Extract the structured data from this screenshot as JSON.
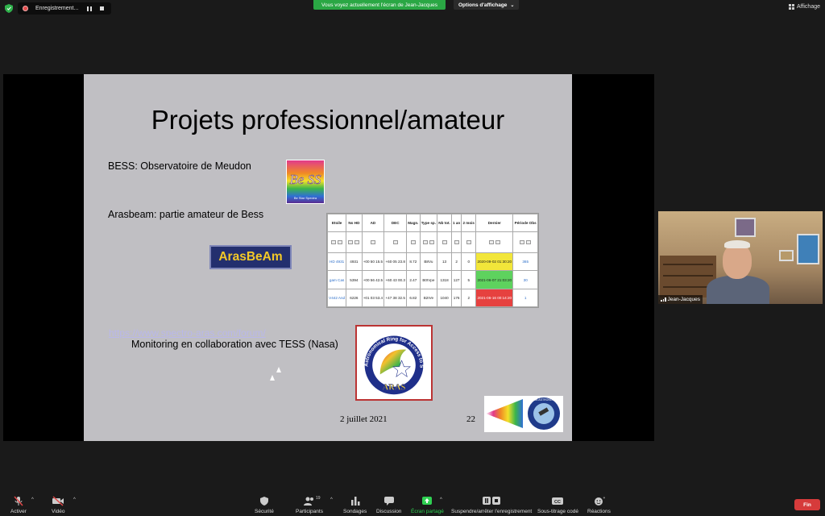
{
  "top_bar": {
    "recording_label": "Enregistrement...",
    "viewing_banner": "Vous voyez actuellement l'écran de Jean-Jacques",
    "view_options": "Options d'affichage",
    "display_label": "Affichage"
  },
  "slide": {
    "title": "Projets professionnel/amateur",
    "bess_text": "BESS: Observatoire de Meudon",
    "arasbeam_text": "Arasbeam: partie amateur de Bess",
    "link": "https://www.spectro-aras.com/forum/",
    "monitoring_text": "Monitoring en collaboration avec TESS (Nasa)",
    "date": "2 juillet 2021",
    "page_number": "22",
    "bess_logo_text": "Be SS",
    "bess_logo_sub": "Be Star Spectra",
    "arasbeam_logo": "ArasBeAm",
    "aras_logo_ring": "Astronomical Ring for Access to Spectroscopy",
    "aras_logo_name": "ARAS",
    "corner_logo_text": "CLUB ASTRONOMIE"
  },
  "table": {
    "headers": [
      "Etoile",
      "No HD",
      "AD",
      "DEC",
      "Magn.",
      "Type sp.",
      "Nb tot.",
      "1 an",
      "2 mois",
      "Dernier",
      "Période Obs"
    ],
    "rows": [
      {
        "star": "HD 4931",
        "hd": "4931",
        "ad": "+00 50 15.5",
        "dec": "+60 05 23.8",
        "mag": "8.72",
        "type": "B8Vu",
        "tot": "13",
        "year": "2",
        "months": "0",
        "last": "2020-09-02 01:30:20",
        "period": "365",
        "status": "yellow"
      },
      {
        "star": "gam Cas",
        "hd": "5394",
        "ad": "+00 56 42.5",
        "dec": "+60 43 00.3",
        "mag": "2.47",
        "type": "B0IVpe",
        "tot": "1318",
        "year": "127",
        "months": "5",
        "last": "2021-06-07 21:03:20",
        "period": "30",
        "status": "green"
      },
      {
        "star": "V442 And",
        "hd": "6226",
        "ad": "+01 03 53.4",
        "dec": "+47 38 32.5",
        "mag": "6.82",
        "type": "B2IVe",
        "tot": "1040",
        "year": "176",
        "months": "2",
        "last": "2021-06-16 00:14:20",
        "period": "1",
        "status": "red"
      }
    ]
  },
  "video": {
    "name": "Jean-Jacques"
  },
  "toolbar": {
    "unmute": "Activer",
    "video": "Vidéo",
    "security": "Sécurité",
    "participants": "Participants",
    "participants_count": "19",
    "polls": "Sondages",
    "chat": "Discussion",
    "share": "Écran partagé",
    "pause_recording": "Suspendre/arrêter l'enregistrement",
    "captions": "Sous-titrage codé",
    "reactions": "Réactions",
    "end": "Fin"
  },
  "colors": {
    "banner_green": "#2aa744",
    "end_red": "#d63b3b",
    "slide_bg": "#c0bfc3",
    "link": "#b9b8ea"
  }
}
